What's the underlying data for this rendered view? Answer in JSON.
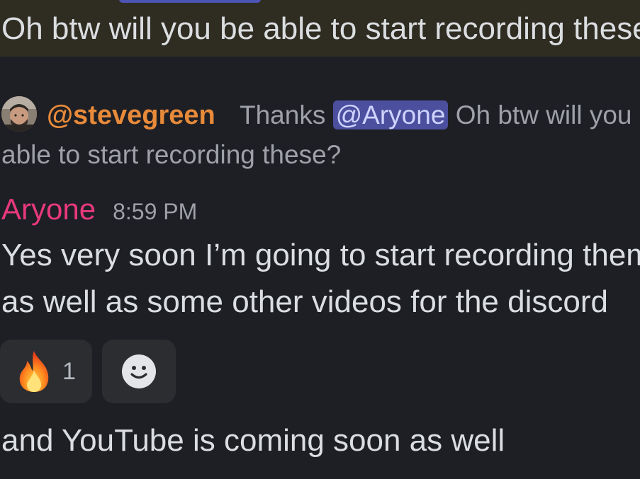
{
  "highlighted_message": {
    "text": "Oh btw will you be able to start recording these?"
  },
  "reply_preview": {
    "author": "@stevegreen",
    "text_before_mention": "Thanks ",
    "mention": "@Aryone",
    "text_after_mention": " Oh btw will you be",
    "continuation": "able to start recording these?"
  },
  "message": {
    "author": "Aryone",
    "timestamp": "8:59 PM",
    "line1": "Yes very soon I’m going to start recording them",
    "line2": "as well as some other videos for the discord",
    "followup": "and YouTube is coming soon as well"
  },
  "reactions": [
    {
      "emoji": "fire",
      "count": "1"
    },
    {
      "emoji": "add-reaction"
    }
  ],
  "colors": {
    "background": "#1e1f24",
    "highlight": "#2f2c22",
    "reply_author": "#e78a3a",
    "author": "#e8397d",
    "mention_bg": "#4b4f9e"
  }
}
